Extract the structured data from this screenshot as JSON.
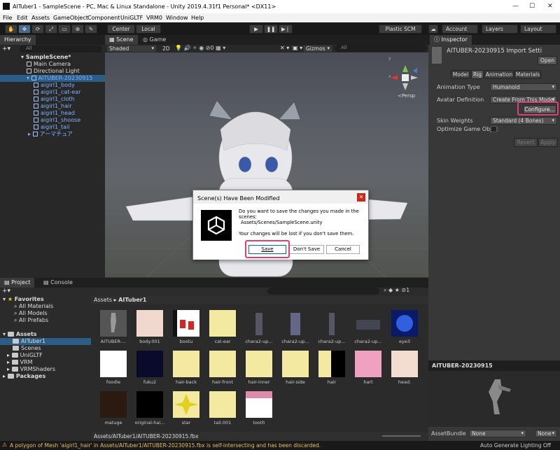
{
  "window": {
    "title": "AITuber1 - SampleScene - PC, Mac & Linux Standalone - Unity 2019.4.31f1 Personal* <DX11>"
  },
  "menu": [
    "File",
    "Edit",
    "Assets",
    "GameObject",
    "Component",
    "UniGLTF",
    "VRM0",
    "Window",
    "Help"
  ],
  "toolbar": {
    "center": "Center",
    "local": "Local",
    "plastic": "Plastic SCM",
    "account": "Account",
    "layers": "Layers",
    "layout": "Layout"
  },
  "hierarchy": {
    "tab": "Hierarchy",
    "search_placeholder": "All",
    "scene": "SampleScene*",
    "items": [
      {
        "label": "Main Camera"
      },
      {
        "label": "Directional Light"
      },
      {
        "label": "AITUBER-20230915"
      },
      {
        "label": "aigirl1_body"
      },
      {
        "label": "aigirl1_cat-ear"
      },
      {
        "label": "aigirl1_cloth"
      },
      {
        "label": "aigirl1_hair"
      },
      {
        "label": "aigirl1_head"
      },
      {
        "label": "aigirl1_shoose"
      },
      {
        "label": "aigirl1_tail"
      },
      {
        "label": "アーマチュア"
      }
    ]
  },
  "scene": {
    "tabs": [
      "Scene",
      "Game"
    ],
    "shading": "Shaded",
    "mode2d": "2D",
    "gizmos": "Gizmos",
    "search": "All",
    "persp": "<Persp"
  },
  "dialog": {
    "title": "Scene(s) Have Been Modified",
    "message": "Do you want to save the changes you made in the scenes:",
    "path": "Assets/Scenes/SampleScene.unity",
    "warning": "Your changes will be lost if you don't save them.",
    "save": "Save",
    "dont_save": "Don't Save",
    "cancel": "Cancel"
  },
  "inspector": {
    "tab": "Inspector",
    "title": "AITUBER-20230915 Import Setti",
    "open": "Open",
    "tabs": [
      "Model",
      "Rig",
      "Animation",
      "Materials"
    ],
    "animation_type_label": "Animation Type",
    "animation_type": "Humanoid",
    "avatar_def_label": "Avatar Definition",
    "avatar_def": "Create From This Model",
    "configure": "Configure...",
    "skin_weights_label": "Skin Weights",
    "skin_weights": "Standard (4 Bones)",
    "optimize_label": "Optimize Game Objec",
    "revert": "Revert",
    "apply": "Apply",
    "preview_title": "AITUBER-20230915",
    "assetbundle_label": "AssetBundle",
    "assetbundle": "None",
    "variant": "None"
  },
  "project": {
    "tabs": [
      "Project",
      "Console"
    ],
    "breadcrumb": [
      "Assets",
      "AITuber1"
    ],
    "favorites": "Favorites",
    "fav_items": [
      "All Materials",
      "All Models",
      "All Prefabs"
    ],
    "assets": "Assets",
    "folders": [
      "AITuber1",
      "Scenes",
      "UniGLTF",
      "VRM",
      "VRMShaders"
    ],
    "packages": "Packages",
    "thumbs": [
      "AITUBER-...",
      "body.001",
      "bootu",
      "cat-ear",
      "chara2-up...",
      "chara2-up...",
      "chara2-up...",
      "chara2-up...",
      "eye3",
      "foodie",
      "fuku2",
      "hair-back",
      "hair-front",
      "hair-inner",
      "hair-side",
      "hair",
      "hart",
      "head.",
      "matuge",
      "original-hai...",
      "star",
      "tail.001",
      "tooth"
    ],
    "path": "Assets/AITuber1/AITUBER-20230915.fbx",
    "count": "1"
  },
  "status": {
    "message": "A polygon of Mesh 'aigirl1_hair' in Assets/AITuber1/AITUBER-20230915.fbx is self-intersecting and has been discarded.",
    "right": "Auto Generate Lighting Off"
  }
}
